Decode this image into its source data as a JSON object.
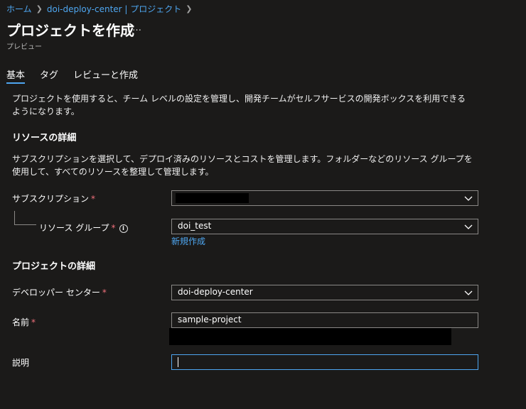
{
  "breadcrumb": {
    "home": "ホーム",
    "center": "doi-deploy-center | プロジェクト"
  },
  "header": {
    "title": "プロジェクトを作成",
    "more": "…",
    "subtitle": "プレビュー"
  },
  "tabs": [
    {
      "label": "基本",
      "active": true
    },
    {
      "label": "タグ",
      "active": false
    },
    {
      "label": "レビューと作成",
      "active": false
    }
  ],
  "intro": "プロジェクトを使用すると、チーム レベルの設定を管理し、開発チームがセルフサービスの開発ボックスを利用できるようになります。",
  "resource_section": {
    "heading": "リソースの詳細",
    "description": "サブスクリプションを選択して、デプロイ済みのリソースとコストを管理します。フォルダーなどのリソース グループを使用して、すべてのリソースを整理して管理します。",
    "subscription_label": "サブスクリプション",
    "subscription_value": "",
    "resource_group_label": "リソース グループ",
    "resource_group_value": "doi_test",
    "create_new": "新規作成"
  },
  "project_section": {
    "heading": "プロジェクトの詳細",
    "dev_center_label": "デベロッパー センター",
    "dev_center_value": "doi-deploy-center",
    "name_label": "名前",
    "name_value": "sample-project",
    "description_label": "説明",
    "description_value": ""
  },
  "required_marker": "*",
  "colors": {
    "background": "#1b1a19",
    "accent": "#4ea6f0",
    "required": "#f1707b",
    "border": "#8a8886"
  },
  "icons": [
    "chevron-right-icon",
    "more-icon",
    "info-icon",
    "chevron-down-icon"
  ]
}
